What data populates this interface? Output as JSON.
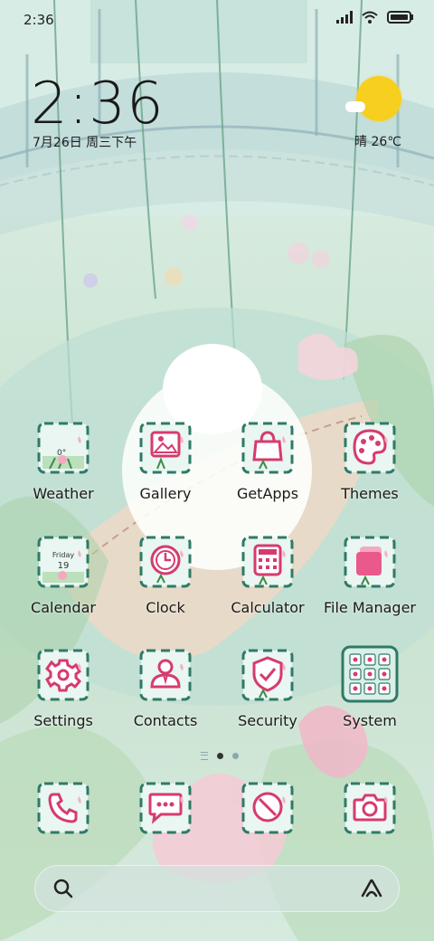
{
  "status_bar": {
    "time": "2:36"
  },
  "clock_widget": {
    "time": "2:36",
    "date": "7月26日 周三下午"
  },
  "weather_widget": {
    "condition_temp": "晴 26℃"
  },
  "apps": [
    {
      "label": "Weather",
      "icon": "weather-icon",
      "tile_text": "0°"
    },
    {
      "label": "Gallery",
      "icon": "gallery-icon"
    },
    {
      "label": "GetApps",
      "icon": "shopping-bag-icon"
    },
    {
      "label": "Themes",
      "icon": "palette-icon"
    },
    {
      "label": "Calendar",
      "icon": "calendar-icon",
      "tile_day": "Friday",
      "tile_date": "19"
    },
    {
      "label": "Clock",
      "icon": "clock-icon"
    },
    {
      "label": "Calculator",
      "icon": "calculator-icon"
    },
    {
      "label": "File Manager",
      "icon": "folder-icon"
    },
    {
      "label": "Settings",
      "icon": "gear-icon"
    },
    {
      "label": "Contacts",
      "icon": "person-icon"
    },
    {
      "label": "Security",
      "icon": "shield-icon"
    },
    {
      "label": "System",
      "icon": "folder-grid-icon"
    }
  ],
  "dock": [
    {
      "icon": "phone-icon"
    },
    {
      "icon": "message-icon"
    },
    {
      "icon": "browser-icon"
    },
    {
      "icon": "camera-icon"
    }
  ],
  "pager": {
    "pages": 2,
    "active": 1
  },
  "colors": {
    "icon_stroke": "#2f7a67",
    "icon_fill": "#e9f6f1",
    "accent_pink": "#d63b6e",
    "sun": "#f6cf1f"
  }
}
